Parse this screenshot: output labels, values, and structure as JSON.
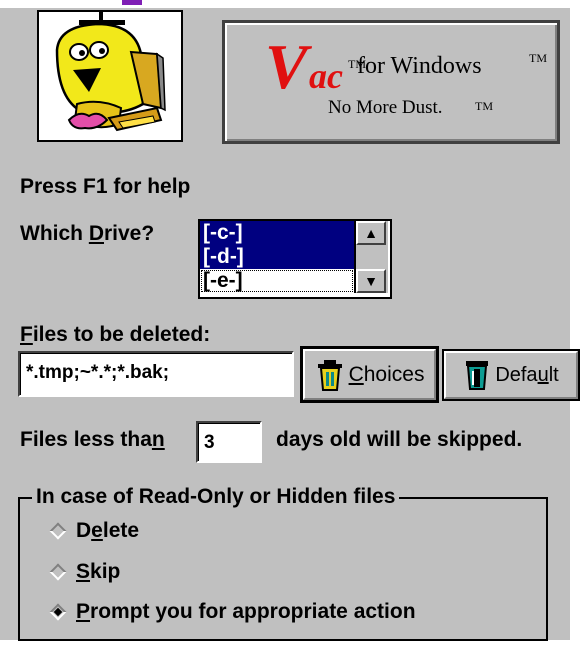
{
  "header": {
    "logo_v": "V",
    "logo_ac": "ac",
    "logo_tm": "TM",
    "logo_for_windows": "for Windows",
    "logo_slogan": "No More Dust.",
    "slogan_tm": "TM"
  },
  "help_text": "Press F1 for help",
  "drive": {
    "label_prefix": "Which ",
    "label_hotkey": "D",
    "label_suffix": "rive?",
    "options": [
      "[-c-]",
      "[-d-]",
      "[-e-]"
    ],
    "selected": [
      "[-c-]",
      "[-d-]"
    ],
    "focused": "[-e-]"
  },
  "files": {
    "label_hotkey": "F",
    "label_rest": "iles to be deleted:",
    "value": "*.tmp;~*.*;*.bak;",
    "choices_hotkey": "C",
    "choices_rest": "hoices",
    "default_prefix": "Defa",
    "default_hotkey": "u",
    "default_suffix": "lt"
  },
  "age": {
    "prefix": "Files less tha",
    "hotkey": "n",
    "value": "3",
    "suffix": "days old will be skipped."
  },
  "readonly_group": {
    "title": "In case of Read-Only or Hidden files",
    "options": [
      {
        "prefix": "D",
        "hotkey": "e",
        "rest": "lete",
        "checked": false
      },
      {
        "prefix": "",
        "hotkey": "S",
        "rest": "kip",
        "checked": false
      },
      {
        "prefix": "",
        "hotkey": "P",
        "rest": "rompt you for appropriate action",
        "checked": true
      }
    ]
  },
  "colors": {
    "panel": "#c0c0c0",
    "selection": "#000080",
    "logo_red": "#e01010",
    "link_purple": "#7f1fb5"
  }
}
